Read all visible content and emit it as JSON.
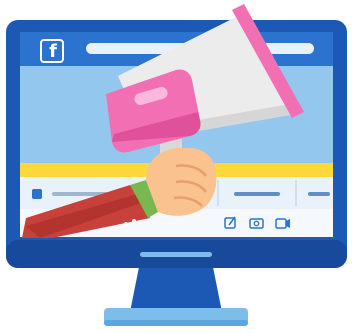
{
  "illustration": {
    "brand_icon": "facebook-icon",
    "brand_letter": "f",
    "toolbar_icons": [
      "edit-icon",
      "camera-icon",
      "video-icon"
    ]
  },
  "colors": {
    "monitor_frame": "#1c59b5",
    "screen_bezel": "#1e60bf",
    "screen_header": "#2c72cf",
    "screen_body": "#93c7ee",
    "yellow_stripe": "#ffd93c",
    "toolbar": "#e9f2fb",
    "megaphone_body": "#ececec",
    "megaphone_pink": "#f36fb3",
    "hand_skin": "#f9c28e",
    "sleeve": "#c8403a",
    "cuff": "#79b84e",
    "stand": "#1c59b5",
    "stand_base": "#7cbde9"
  }
}
